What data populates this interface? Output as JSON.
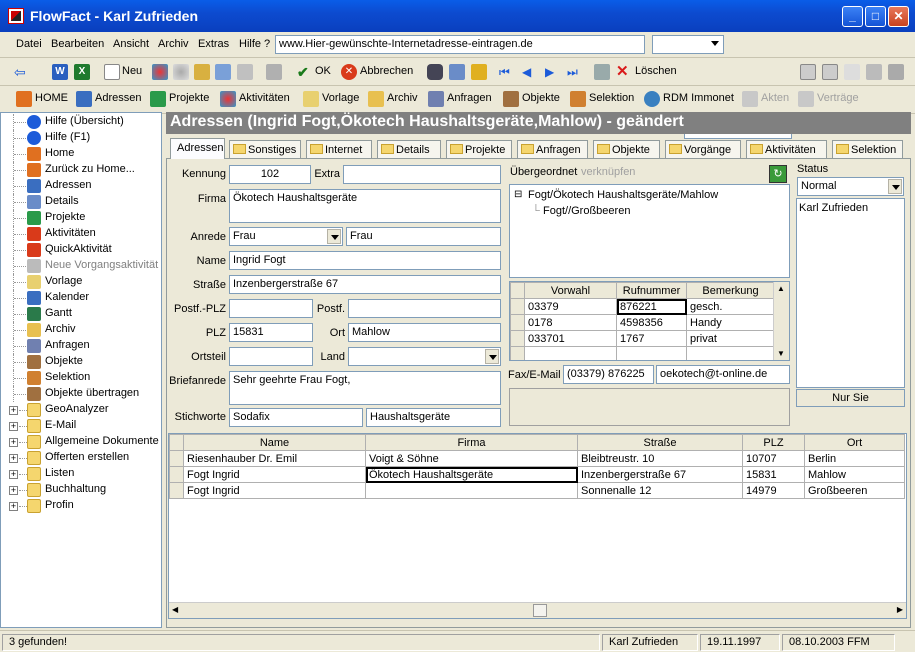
{
  "window": {
    "title": "FlowFact - Karl Zufrieden"
  },
  "menu": {
    "items": [
      "Datei",
      "Bearbeiten",
      "Ansicht",
      "Archiv",
      "Extras",
      "Hilfe ?"
    ],
    "url": "www.Hier-gewünschte-Internetadresse-eintragen.de"
  },
  "toolbar1": {
    "new_label": "Neu",
    "ok_label": "OK",
    "cancel_label": "Abbrechen",
    "delete_label": "Löschen"
  },
  "toolbar2": {
    "items": [
      "HOME",
      "Adressen",
      "Projekte",
      "Aktivitäten",
      "Vorlage",
      "Archiv",
      "Anfragen",
      "Objekte",
      "Selektion",
      "RDM Immonet",
      "Akten",
      "Verträge"
    ]
  },
  "tree": {
    "items": [
      "Hilfe (Übersicht)",
      "Hilfe (F1)",
      "Home",
      "Zurück zu Home...",
      "Adressen",
      "Details",
      "Projekte",
      "Aktivitäten",
      "QuickAktivität",
      "Neue Vorgangsaktivität",
      "Vorlage",
      "Kalender",
      "Gantt",
      "Archiv",
      "Anfragen",
      "Objekte",
      "Selektion",
      "Objekte übertragen",
      "GeoAnalyzer",
      "E-Mail",
      "Allgemeine Dokumente",
      "Offerten erstellen",
      "Listen",
      "Buchhaltung",
      "Profin"
    ]
  },
  "header": {
    "title": "Adressen (Ingrid Fogt,Ökotech Haushaltsgeräte,Mahlow) - geändert"
  },
  "tabs": [
    "Adressen",
    "Sonstiges",
    "Internet",
    "Details",
    "Projekte",
    "Anfragen",
    "Objekte",
    "Vorgänge",
    "Aktivitäten",
    "Selektion"
  ],
  "form": {
    "kennung_label": "Kennung",
    "kennung": "102",
    "extra_label": "Extra",
    "extra": "",
    "firma_label": "Firma",
    "firma": "Ökotech Haushaltsgeräte",
    "anrede_label": "Anrede",
    "anrede": "Frau",
    "anrede2": "Frau",
    "name_label": "Name",
    "name": "Ingrid Fogt",
    "strasse_label": "Straße",
    "strasse": "Inzenbergerstraße 67",
    "postfplz_label": "Postf.-PLZ",
    "postfplz": "",
    "postf_label": "Postf.",
    "postf": "",
    "plz_label": "PLZ",
    "plz": "15831",
    "ort_label": "Ort",
    "ort": "Mahlow",
    "ortsteil_label": "Ortsteil",
    "ortsteil": "",
    "land_label": "Land",
    "land": "",
    "briefanrede_label": "Briefanrede",
    "briefanrede": "Sehr geehrte Frau Fogt,",
    "stichworte_label": "Stichworte",
    "stichworte1": "Sodafix",
    "stichworte2": "Haushaltsgeräte"
  },
  "uebergeordnet": {
    "label": "Übergeordnet",
    "link": "verknüpfen",
    "nodes": [
      "Fogt/Ökotech Haushaltsgeräte/Mahlow",
      "Fogt//Großbeeren"
    ]
  },
  "phones": {
    "headers": [
      "Vorwahl",
      "Rufnummer",
      "Bemerkung"
    ],
    "rows": [
      [
        "03379",
        "876221",
        "gesch."
      ],
      [
        "0178",
        "4598356",
        "Handy"
      ],
      [
        "033701",
        "1767",
        "privat"
      ]
    ]
  },
  "fax": {
    "label": "Fax/E-Mail",
    "fax": "(03379)  876225",
    "email": "oekotech@t-online.de"
  },
  "status": {
    "label": "Status",
    "value": "Normal",
    "list": [
      "Karl Zufrieden"
    ],
    "button": "Nur Sie"
  },
  "results": {
    "headers": [
      "Name",
      "Firma",
      "Straße",
      "PLZ",
      "Ort"
    ],
    "rows": [
      [
        "Riesenhauber Dr. Emil",
        "Voigt & Söhne",
        "Bleibtreustr. 10",
        "10707",
        "Berlin"
      ],
      [
        "Fogt Ingrid",
        "Ökotech Haushaltsgeräte",
        "Inzenbergerstraße 67",
        "15831",
        "Mahlow"
      ],
      [
        "Fogt Ingrid",
        "",
        "Sonnenalle 12",
        "14979",
        "Großbeeren"
      ]
    ]
  },
  "statusbar": {
    "count": "3 gefunden!",
    "user": "Karl Zufrieden",
    "date1": "19.11.1997",
    "date2": "08.10.2003 FFM"
  },
  "colors": {
    "titlebar": "#0a4fd6",
    "header": "#808080"
  }
}
